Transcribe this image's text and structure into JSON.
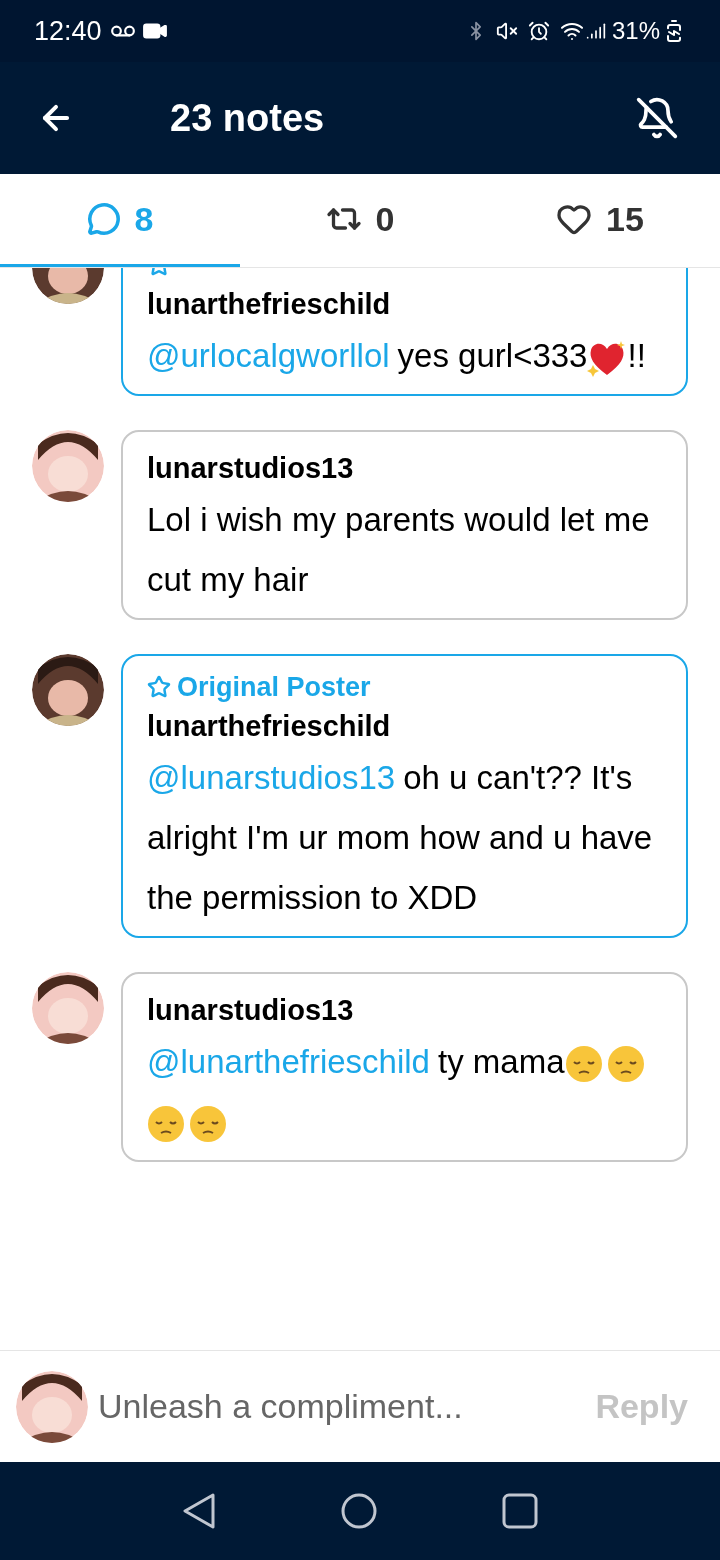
{
  "status_bar": {
    "time": "12:40",
    "battery": "31%"
  },
  "header": {
    "title": "23 notes"
  },
  "tabs": [
    {
      "kind": "replies",
      "count": "8",
      "selected": true
    },
    {
      "kind": "reblogs",
      "count": "0",
      "selected": false
    },
    {
      "kind": "likes",
      "count": "15",
      "selected": false
    }
  ],
  "replies": [
    {
      "original_poster": true,
      "username": "lunarthefrieschild",
      "message": [
        {
          "kind": "mention",
          "text": "@urlocalgworllol"
        },
        {
          "kind": "text",
          "text": "yes gurl<333"
        },
        {
          "kind": "heart-emoji"
        },
        {
          "kind": "text",
          "text": "!!"
        }
      ]
    },
    {
      "original_poster": false,
      "username": "lunarstudios13",
      "message": [
        {
          "kind": "text",
          "text": "Lol i wish my parents would let me cut my hair"
        }
      ]
    },
    {
      "original_poster": true,
      "badge": "Original Poster",
      "username": "lunarthefrieschild",
      "message": [
        {
          "kind": "mention",
          "text": "@lunarstudios13"
        },
        {
          "kind": "text",
          "text": "oh u can't?? It's alright I'm ur mom how and u have the permission to XDD"
        }
      ]
    },
    {
      "original_poster": false,
      "username": "lunarstudios13",
      "message": [
        {
          "kind": "mention",
          "text": "@lunarthefrieschild"
        },
        {
          "kind": "text",
          "text": "ty mama"
        },
        {
          "kind": "pensive-emoji"
        },
        {
          "kind": "pensive-emoji"
        },
        {
          "kind": "pensive-emoji"
        },
        {
          "kind": "pensive-emoji"
        }
      ]
    }
  ],
  "composer": {
    "placeholder": "Unleash a compliment...",
    "button": "Reply",
    "disabled": true
  }
}
